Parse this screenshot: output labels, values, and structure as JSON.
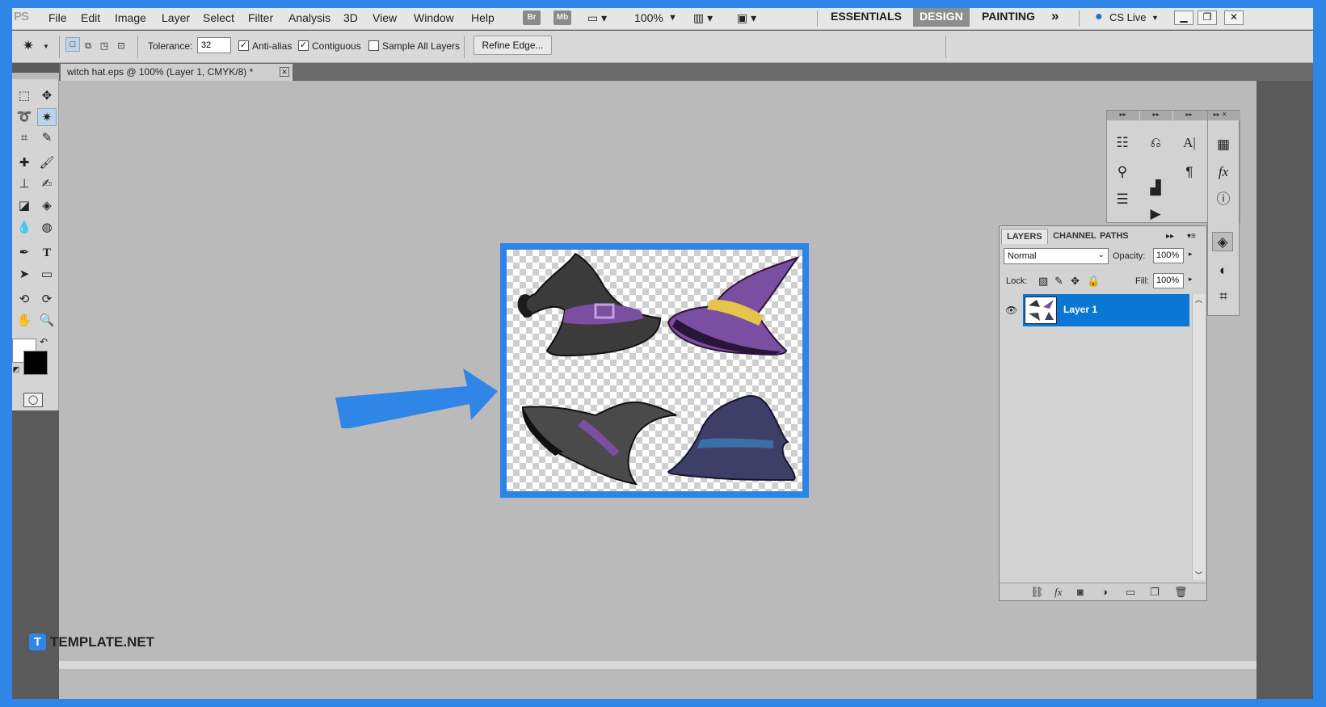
{
  "app": {
    "logo": "PS",
    "menus": [
      "File",
      "Edit",
      "Image",
      "Layer",
      "Select",
      "Filter",
      "Analysis",
      "3D",
      "View",
      "Window",
      "Help"
    ],
    "bridge_btn": "Br",
    "minibridge_btn": "Mb",
    "zoom": "100%",
    "workspaces": [
      "ESSENTIALS",
      "DESIGN",
      "PAINTING"
    ],
    "active_workspace": "DESIGN",
    "more": "»",
    "cs_live": "CS Live"
  },
  "options": {
    "tolerance_label": "Tolerance:",
    "tolerance_value": "32",
    "anti_alias": "Anti-alias",
    "contiguous": "Contiguous",
    "sample_all": "Sample All Layers",
    "refine_edge": "Refine Edge..."
  },
  "document": {
    "tab_title": "witch hat.eps @ 100% (Layer 1, CMYK/8) *"
  },
  "layers_panel": {
    "tabs": [
      "LAYERS",
      "CHANNEL",
      "PATHS"
    ],
    "blend_mode": "Normal",
    "opacity_label": "Opacity:",
    "opacity_value": "100%",
    "lock_label": "Lock:",
    "fill_label": "Fill:",
    "fill_value": "100%",
    "layer_name": "Layer 1"
  },
  "watermark": {
    "badge": "T",
    "text": "TEMPLATE.NET"
  },
  "colors": {
    "accent": "#2f86e6",
    "layer_selected": "#0a76d6",
    "canvas_bg": "#bababa"
  }
}
